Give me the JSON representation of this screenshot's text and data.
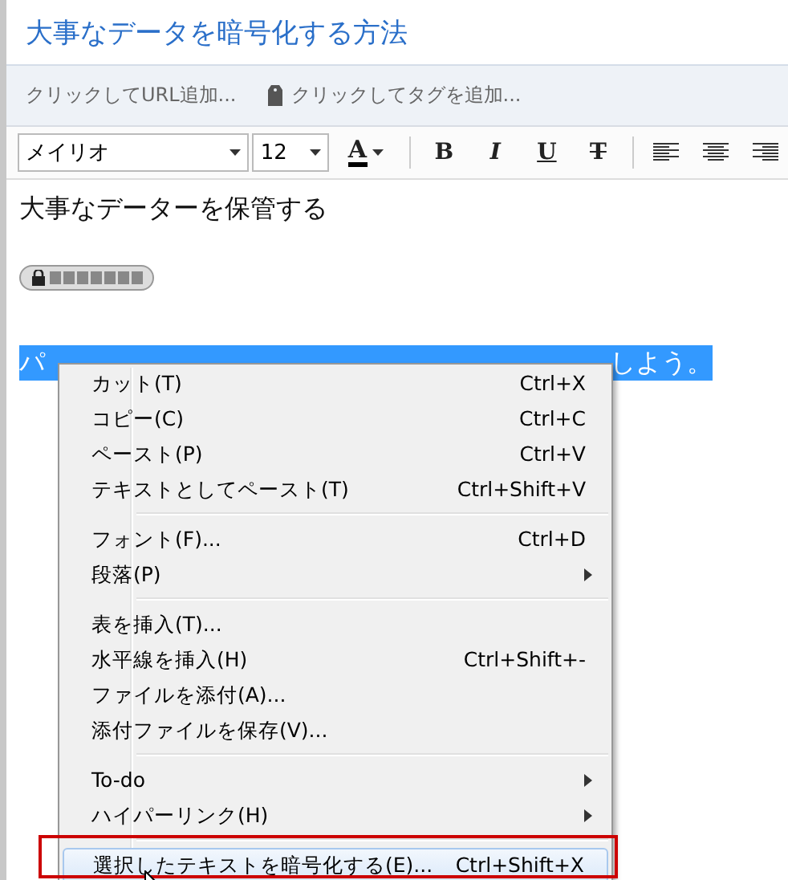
{
  "note": {
    "title": "大事なデータを暗号化する方法"
  },
  "tag_bar": {
    "url_placeholder": "クリックしてURL追加...",
    "tag_placeholder": "クリックしてタグを追加..."
  },
  "toolbar": {
    "font": "メイリオ",
    "size": "12",
    "color_label": "A",
    "format_buttons": [
      "B",
      "I",
      "U",
      "T"
    ]
  },
  "body": {
    "heading": "大事なデーターを保管する",
    "selected_text_left": "パ",
    "selected_text_right": "しよう。"
  },
  "context_menu": {
    "groups": [
      {
        "items": [
          {
            "label": "カット(T)",
            "shortcut": "Ctrl+X",
            "has_submenu": false,
            "selected": false
          },
          {
            "label": "コピー(C)",
            "shortcut": "Ctrl+C",
            "has_submenu": false,
            "selected": false
          },
          {
            "label": "ペースト(P)",
            "shortcut": "Ctrl+V",
            "has_submenu": false,
            "selected": false
          },
          {
            "label": "テキストとしてペースト(T)",
            "shortcut": "Ctrl+Shift+V",
            "has_submenu": false,
            "selected": false
          }
        ]
      },
      {
        "items": [
          {
            "label": "フォント(F)...",
            "shortcut": "Ctrl+D",
            "has_submenu": false,
            "selected": false
          },
          {
            "label": "段落(P)",
            "has_submenu": true,
            "selected": false
          }
        ]
      },
      {
        "items": [
          {
            "label": "表を挿入(T)...",
            "has_submenu": false,
            "selected": false
          },
          {
            "label": "水平線を挿入(H)",
            "shortcut": "Ctrl+Shift+-",
            "has_submenu": false,
            "selected": false
          },
          {
            "label": "ファイルを添付(A)...",
            "has_submenu": false,
            "selected": false
          },
          {
            "label": "添付ファイルを保存(V)...",
            "has_submenu": false,
            "selected": false
          }
        ]
      },
      {
        "items": [
          {
            "label": "To-do",
            "has_submenu": true,
            "selected": false
          },
          {
            "label": "ハイパーリンク(H)",
            "has_submenu": true,
            "selected": false
          }
        ]
      },
      {
        "items": [
          {
            "label": "選択したテキストを暗号化する(E)...",
            "shortcut": "Ctrl+Shift+X",
            "has_submenu": false,
            "selected": true
          }
        ]
      }
    ]
  }
}
